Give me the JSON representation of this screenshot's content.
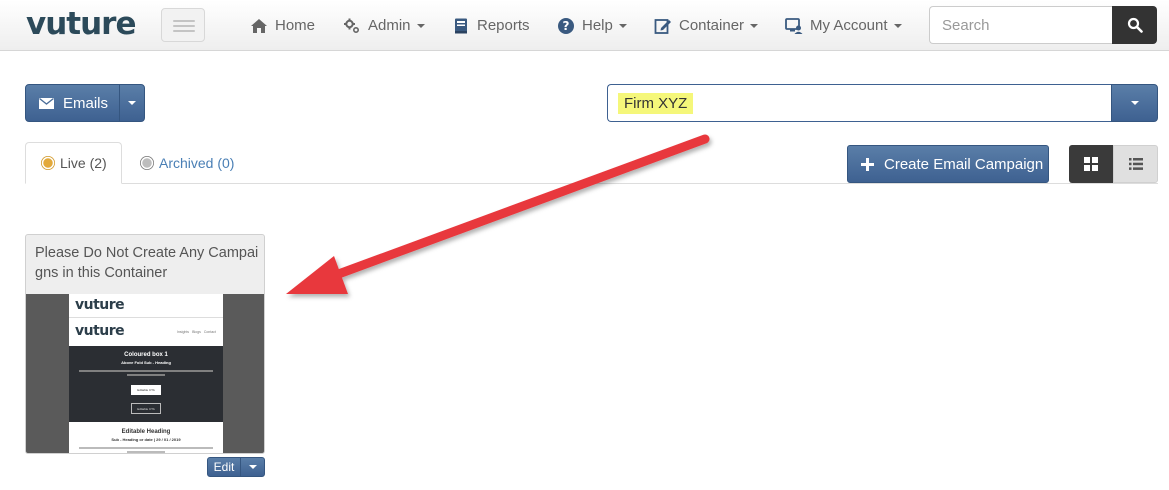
{
  "brand": {
    "logo_text": "vuture"
  },
  "nav": {
    "items": [
      {
        "label": "Home",
        "icon": "home-icon",
        "has_caret": false
      },
      {
        "label": "Admin",
        "icon": "gears-icon",
        "has_caret": true
      },
      {
        "label": "Reports",
        "icon": "book-icon",
        "has_caret": false
      },
      {
        "label": "Help",
        "icon": "question-circle-icon",
        "has_caret": true
      },
      {
        "label": "Container",
        "icon": "edit-icon",
        "has_caret": true
      },
      {
        "label": "My Account",
        "icon": "user-monitor-icon",
        "has_caret": true
      }
    ],
    "search": {
      "placeholder": "Search",
      "value": ""
    }
  },
  "toolbar": {
    "emails_label": "Emails",
    "container_value": "Firm XYZ",
    "create_campaign_label": "Create Email Campaign"
  },
  "tabs": [
    {
      "label": "Live (2)",
      "active": true,
      "dot_color": "#e3a93a"
    },
    {
      "label": "Archived (0)",
      "active": false,
      "dot_color": "#bdbdbd"
    }
  ],
  "view_toggle": {
    "active": "grid"
  },
  "campaigns": [
    {
      "title": "Please Do Not Create Any Campaigns in this Container",
      "edit_label": "Edit",
      "preview": {
        "logo_top": "vuture",
        "logo_header": "vuture",
        "nav_links": [
          "Insights",
          "Blogs",
          "Contact"
        ],
        "box_heading": "Coloured box 1",
        "box_subheading": "Above Fold Sub - Heading",
        "cta_primary": "Editable CTA",
        "cta_secondary": "Editable CTA",
        "section_heading": "Editable Heading",
        "section_subheading": "Sub - Heading or date | 29 / 01 / 2019"
      }
    }
  ],
  "colors": {
    "primary": "#3e6191",
    "highlight": "#f5f77a",
    "annotation_arrow": "#e8383d",
    "dark_button": "#333333"
  }
}
